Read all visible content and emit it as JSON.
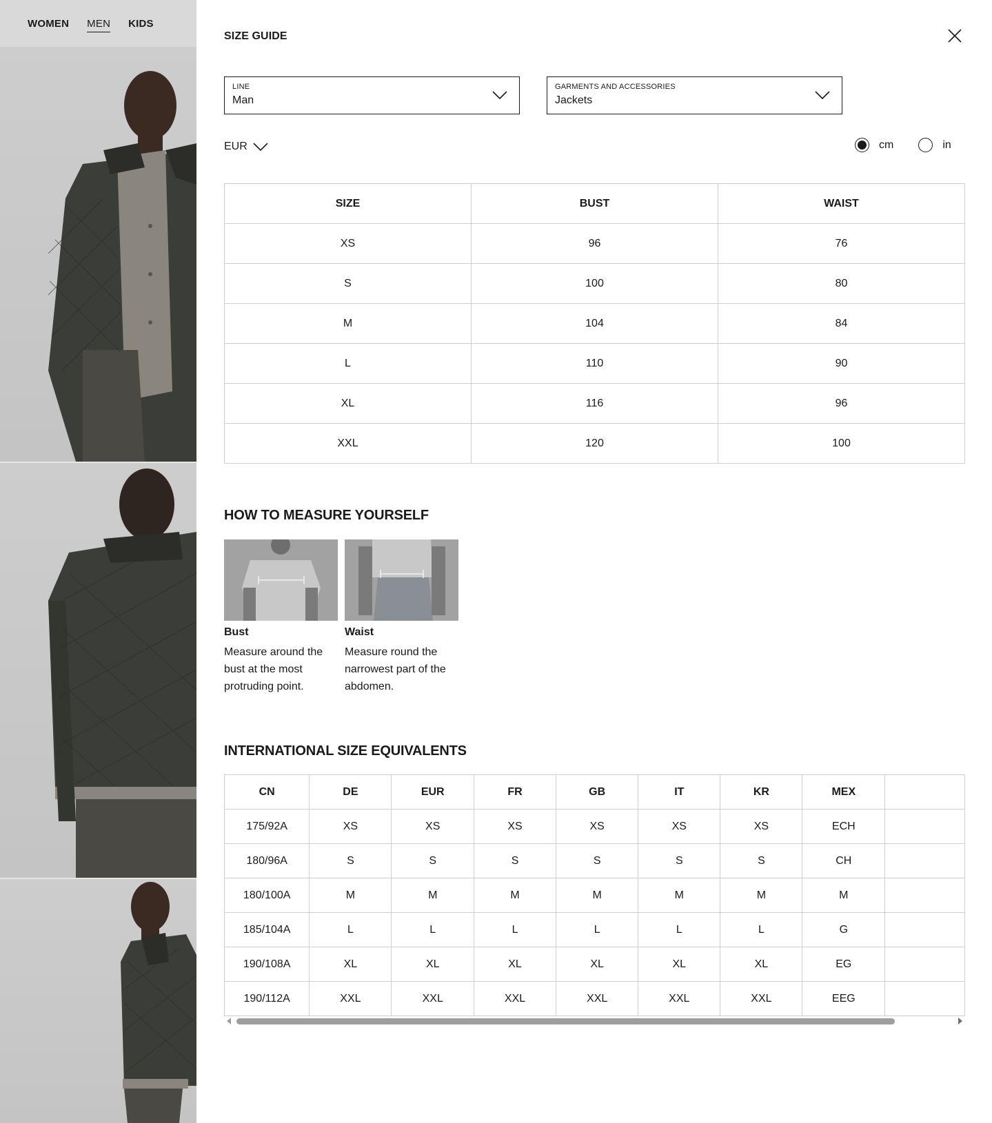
{
  "nav": {
    "items": [
      {
        "label": "WOMEN",
        "active": false
      },
      {
        "label": "MEN",
        "active": true
      },
      {
        "label": "KIDS",
        "active": false
      }
    ]
  },
  "size_guide": {
    "title": "SIZE GUIDE",
    "line_select": {
      "label": "LINE",
      "value": "Man"
    },
    "garment_select": {
      "label": "GARMENTS AND ACCESSORIES",
      "value": "Jackets"
    },
    "currency": "EUR",
    "units": {
      "cm": "cm",
      "in": "in",
      "selected": "cm"
    },
    "table": {
      "headers": [
        "SIZE",
        "BUST",
        "WAIST"
      ],
      "rows": [
        [
          "XS",
          "96",
          "76"
        ],
        [
          "S",
          "100",
          "80"
        ],
        [
          "M",
          "104",
          "84"
        ],
        [
          "L",
          "110",
          "90"
        ],
        [
          "XL",
          "116",
          "96"
        ],
        [
          "XXL",
          "120",
          "100"
        ]
      ]
    }
  },
  "measure": {
    "heading": "HOW TO MEASURE YOURSELF",
    "items": [
      {
        "name": "Bust",
        "desc": "Measure around the bust at the most protruding point."
      },
      {
        "name": "Waist",
        "desc": "Measure round the narrowest part of the abdomen."
      }
    ]
  },
  "international": {
    "heading": "INTERNATIONAL SIZE EQUIVALENTS",
    "headers": [
      "CN",
      "DE",
      "EUR",
      "FR",
      "GB",
      "IT",
      "KR",
      "MEX",
      ""
    ],
    "rows": [
      [
        "175/92A",
        "XS",
        "XS",
        "XS",
        "XS",
        "XS",
        "XS",
        "ECH",
        ""
      ],
      [
        "180/96A",
        "S",
        "S",
        "S",
        "S",
        "S",
        "S",
        "CH",
        ""
      ],
      [
        "180/100A",
        "M",
        "M",
        "M",
        "M",
        "M",
        "M",
        "M",
        ""
      ],
      [
        "185/104A",
        "L",
        "L",
        "L",
        "L",
        "L",
        "L",
        "G",
        ""
      ],
      [
        "190/108A",
        "XL",
        "XL",
        "XL",
        "XL",
        "XL",
        "XL",
        "EG",
        ""
      ],
      [
        "190/112A",
        "XXL",
        "XXL",
        "XXL",
        "XXL",
        "XXL",
        "XXL",
        "EEG",
        ""
      ]
    ]
  },
  "icons": {
    "close": "close-icon",
    "chevron": "chevron-down-icon"
  },
  "colors": {
    "text": "#1a1a1a",
    "border": "#cfcfcf",
    "rail_bg": "#c9c9c9",
    "jacket": "#3b3d38"
  }
}
